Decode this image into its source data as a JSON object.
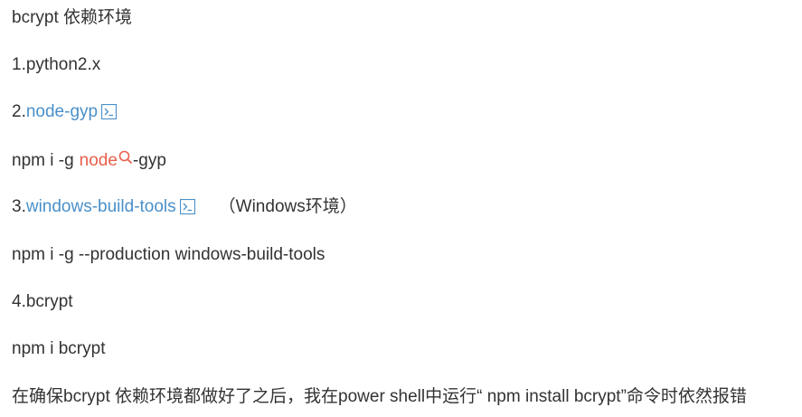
{
  "lines": {
    "l1": "bcrypt 依赖环境",
    "l2": "1.python2.x",
    "l3_prefix": "2.",
    "l3_link": "node-gyp",
    "l4_prefix": "npm i -g",
    "l4_term": "node",
    "l4_suffix": "-gyp",
    "l5_prefix": "3.",
    "l5_link": "windows-build-tools",
    "l5_suffix": "（Windows环境）",
    "l6": "npm i -g --production windows-build-tools",
    "l7": "4.bcrypt",
    "l8": "npm i bcrypt",
    "l9": "在确保bcrypt 依赖环境都做好了之后，我在power shell中运行“ npm install bcrypt”命令时依然报错"
  },
  "icons": {
    "terminal": "terminal-icon",
    "search": "search-icon"
  },
  "colors": {
    "text": "#333333",
    "link": "#4a90c9",
    "search_term": "#e8604c"
  }
}
